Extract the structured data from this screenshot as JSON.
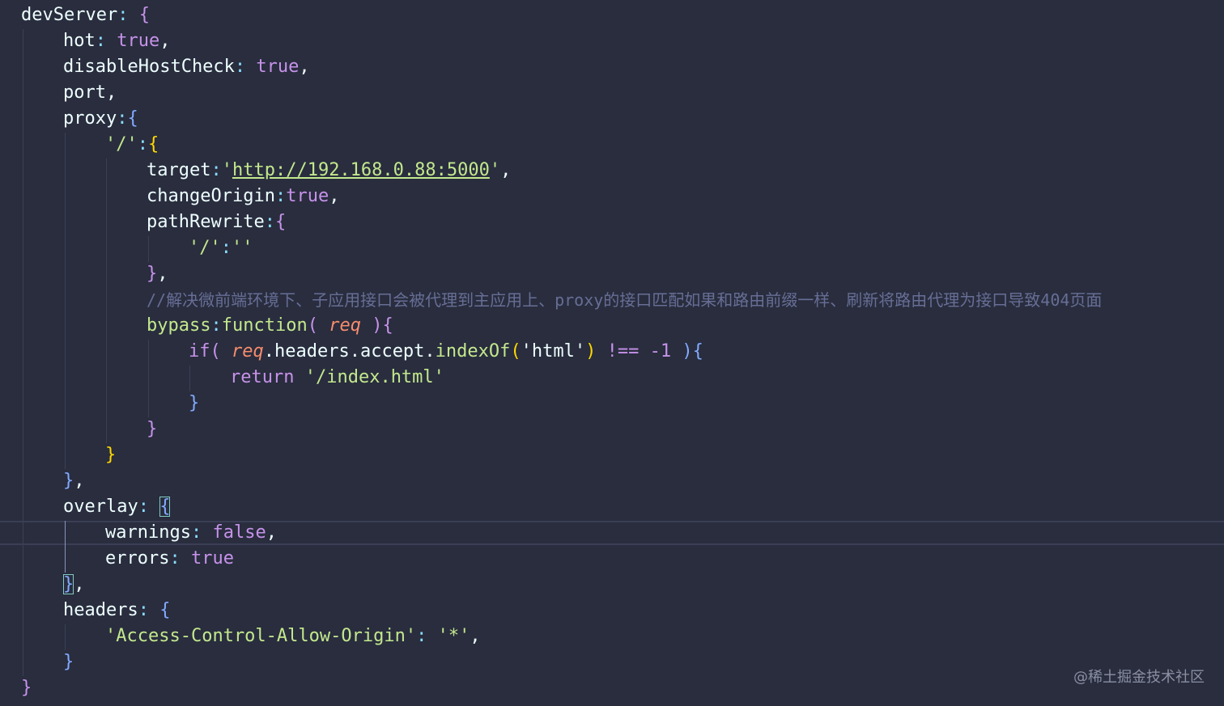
{
  "colors": {
    "background": "#292d3e",
    "property": "#eeffff",
    "punctuation": "#89ddff",
    "keyword": "#c792ea",
    "string": "#c3e88d",
    "bracket_gold": "#ffd700",
    "function": "#82aaff",
    "parameter": "#f78c6c",
    "comment": "#676e95"
  },
  "code": {
    "l1": {
      "prop": "devServer",
      "colon": ":",
      "brace": " {"
    },
    "l2": {
      "prop": "hot",
      "colon": ":",
      "value": " true",
      "comma": ","
    },
    "l3": {
      "prop": "disableHostCheck",
      "colon": ":",
      "value": " true",
      "comma": ","
    },
    "l4": {
      "prop": "port",
      "comma": ","
    },
    "l5": {
      "prop": "proxy",
      "colon": ":",
      "brace": "{"
    },
    "l6": {
      "key": "'/'",
      "colon": ":",
      "brace": "{"
    },
    "l7": {
      "prop": "target",
      "colon": ":",
      "quote_open": "'",
      "url": "http://192.168.0.88:5000",
      "quote_close": "'",
      "comma": ","
    },
    "l8": {
      "prop": "changeOrigin",
      "colon": ":",
      "value": "true",
      "comma": ","
    },
    "l9": {
      "prop": "pathRewrite",
      "colon": ":",
      "brace": "{"
    },
    "l10": {
      "key": "'/'",
      "colon": ":",
      "value": "''"
    },
    "l11": {
      "brace": "}",
      "comma": ","
    },
    "l12": {
      "comment": "//解决微前端环境下、子应用接口会被代理到主应用上、proxy的接口匹配如果和路由前缀一样、刷新将路由代理为接口导致404页面"
    },
    "l13": {
      "prop": "bypass",
      "colon": ":",
      "keyword": "function",
      "paren_open": "( ",
      "param": "req",
      "paren_close": " )",
      "brace": "{"
    },
    "l14": {
      "keyword": "if",
      "paren_open": "( ",
      "param": "req",
      "member": ".headers.accept.",
      "method": "indexOf",
      "call_open": "(",
      "arg": "'html'",
      "call_close": ")",
      "op": " !== ",
      "num": "-1",
      "paren_close": " )",
      "brace": "{"
    },
    "l15": {
      "keyword": "return",
      "value": " '/index.html'"
    },
    "l16": {
      "brace": "}"
    },
    "l17": {
      "brace": "}"
    },
    "l18": {
      "brace": "}"
    },
    "l19": {
      "brace": "}",
      "comma": ","
    },
    "l20": {
      "prop": "overlay",
      "colon": ":",
      "brace": "{"
    },
    "l21": {
      "prop": "warnings",
      "colon": ":",
      "value": " false",
      "comma": ","
    },
    "l22": {
      "prop": "errors",
      "colon": ":",
      "value": " true"
    },
    "l23": {
      "brace": "}",
      "comma": ","
    },
    "l24": {
      "prop": "headers",
      "colon": ":",
      "brace": " {"
    },
    "l25": {
      "key": "'Access-Control-Allow-Origin'",
      "colon": ":",
      "value": " '*'",
      "comma": ","
    },
    "l26": {
      "brace": "}"
    },
    "l27": {
      "brace": "}"
    }
  },
  "watermark": "@稀土掘金技术社区"
}
